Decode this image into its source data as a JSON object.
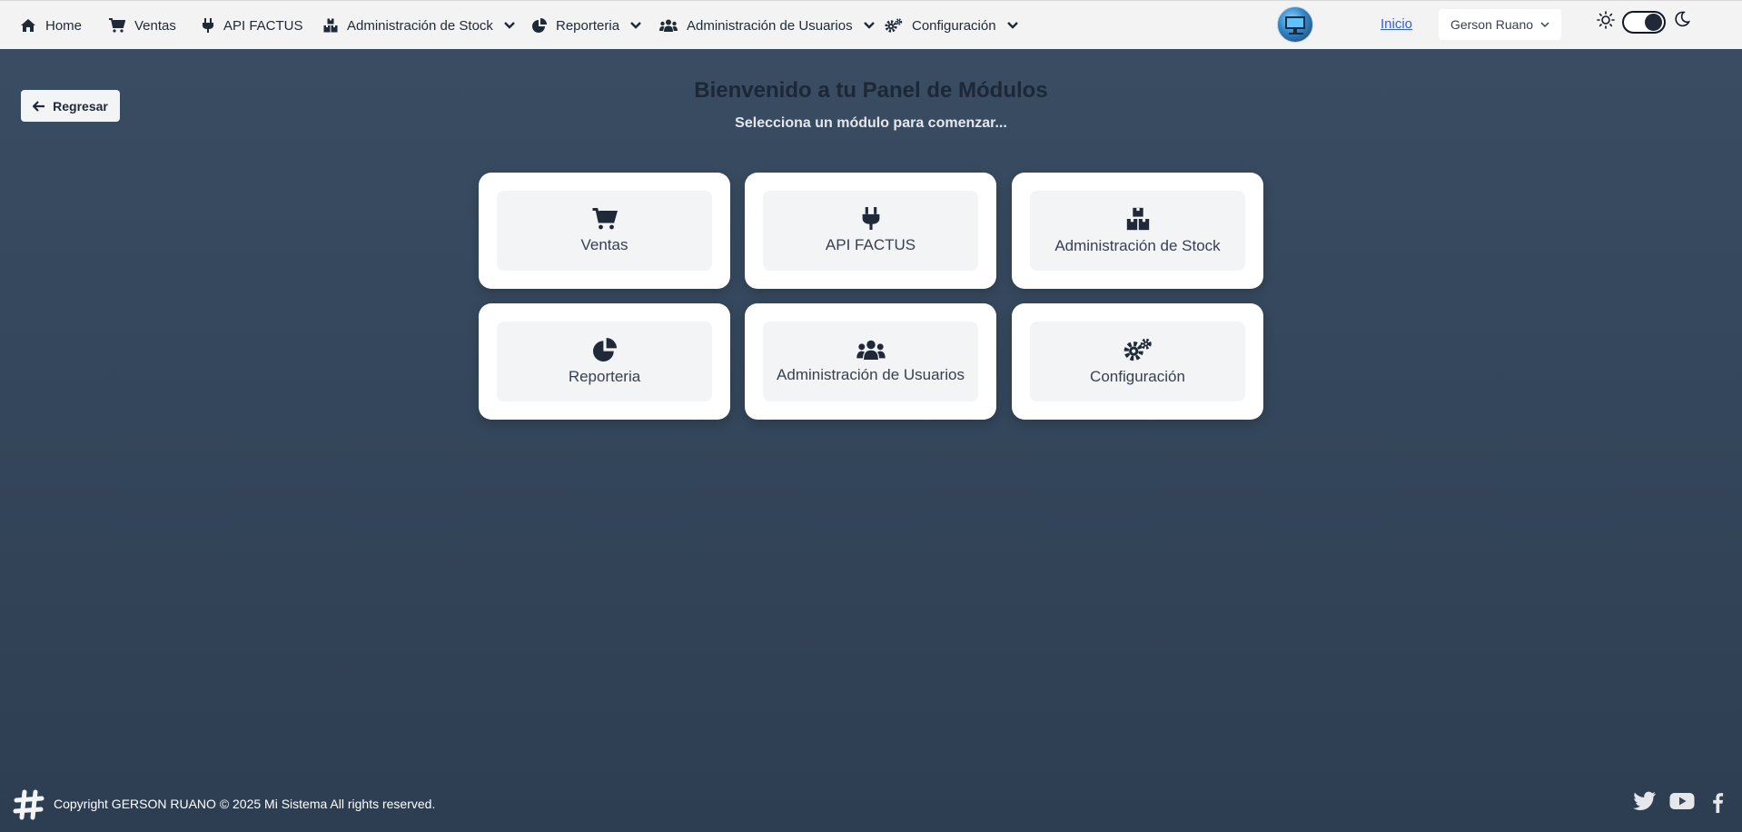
{
  "nav": {
    "items": [
      {
        "label": "Home",
        "icon": "home-icon"
      },
      {
        "label": "Ventas",
        "icon": "cart-icon"
      },
      {
        "label": "API FACTUS",
        "icon": "plug-icon"
      },
      {
        "label": "Administración de Stock",
        "icon": "boxes-icon"
      },
      {
        "label": "Reporteria",
        "icon": "pie-chart-icon"
      },
      {
        "label": "Administración de Usuarios",
        "icon": "users-icon"
      },
      {
        "label": "Configuración",
        "icon": "cogs-icon"
      }
    ],
    "inicio": "Inicio",
    "user": "Gerson Ruano"
  },
  "back_label": "Regresar",
  "title": "Bienvenido a tu Panel de Módulos",
  "subtitle": "Selecciona un módulo para comenzar...",
  "modules": [
    {
      "label": "Ventas",
      "icon": "cart-icon"
    },
    {
      "label": "API FACTUS",
      "icon": "plug-icon"
    },
    {
      "label": "Administración de Stock",
      "icon": "boxes-icon"
    },
    {
      "label": "Reporteria",
      "icon": "pie-chart-icon"
    },
    {
      "label": "Administración de Usuarios",
      "icon": "users-icon"
    },
    {
      "label": "Configuración",
      "icon": "cogs-icon"
    }
  ],
  "footer": {
    "copyright": "Copyright GERSON RUANO © 2025 Mi Sistema All rights reserved.",
    "social": [
      "twitter-icon",
      "youtube-icon",
      "facebook-icon"
    ]
  },
  "colors": {
    "nav_bg": "#f3f3f4",
    "page_bg": "#34465b",
    "link": "#2f5fe0",
    "icon": "#1f2937"
  }
}
